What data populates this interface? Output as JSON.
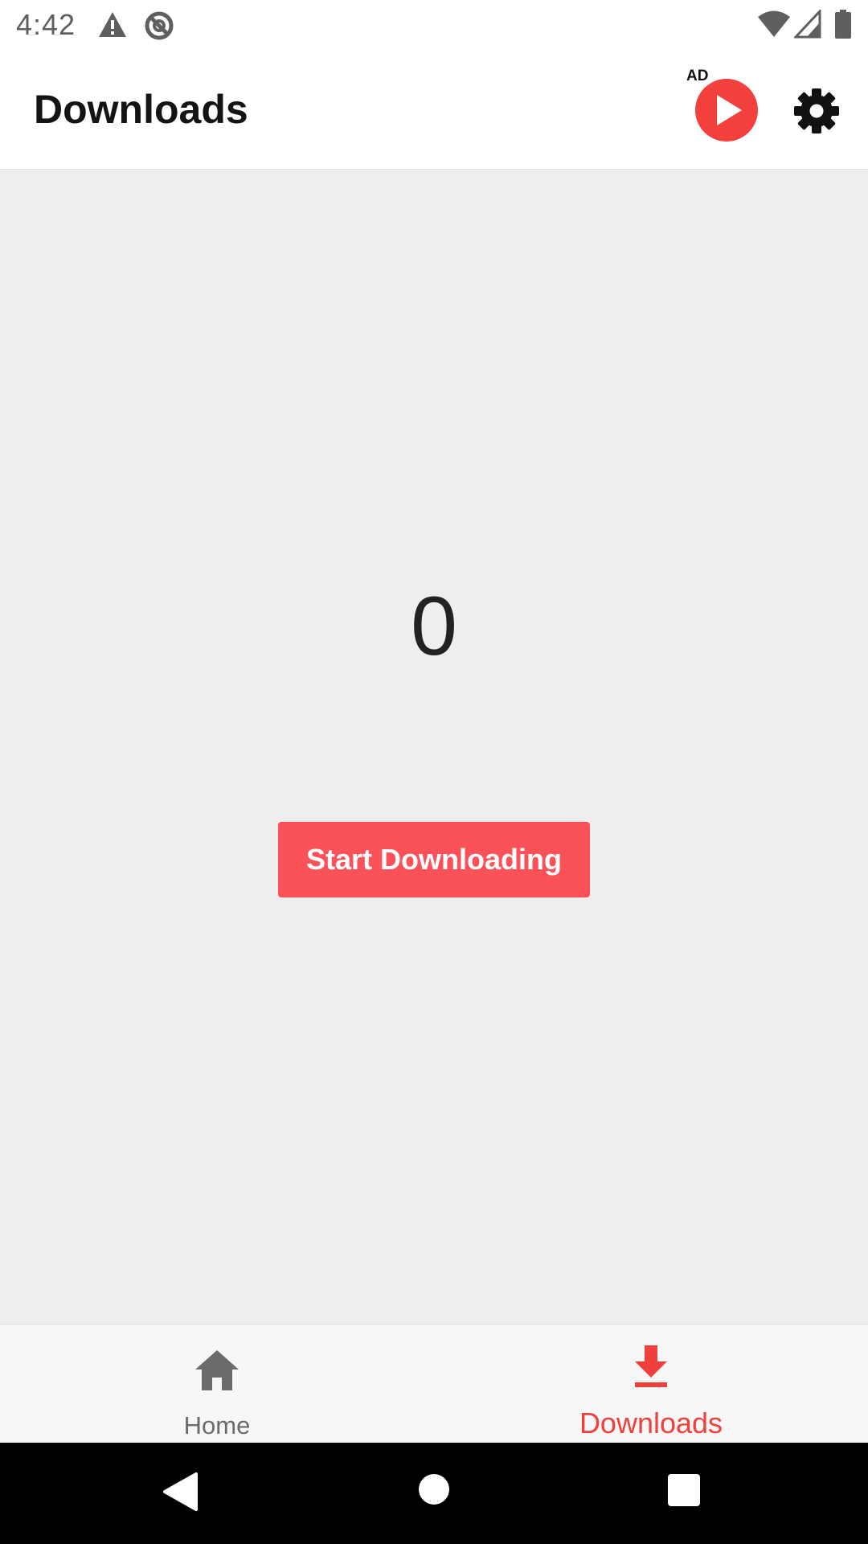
{
  "status_bar": {
    "time": "4:42",
    "icons": [
      "warning-icon",
      "data-saver-icon",
      "wifi-icon",
      "signal-icon",
      "battery-icon"
    ]
  },
  "app_bar": {
    "title": "Downloads",
    "ad_label": "AD",
    "ad_icon": "play-icon",
    "settings_icon": "gear-icon"
  },
  "main": {
    "download_count": "0",
    "start_button_label": "Start Downloading"
  },
  "bottom_nav": {
    "items": [
      {
        "label": "Home",
        "icon": "home-icon",
        "selected": false
      },
      {
        "label": "Downloads",
        "icon": "download-icon",
        "selected": true
      }
    ]
  },
  "system_nav": {
    "buttons": [
      "back-icon",
      "home-circle-icon",
      "recents-icon"
    ]
  },
  "colors": {
    "accent": "#fa5258",
    "active_nav": "#f0403c",
    "ad_play": "#f2403c",
    "content_background": "#efedee",
    "inactive_nav": "#6b6b6b"
  }
}
